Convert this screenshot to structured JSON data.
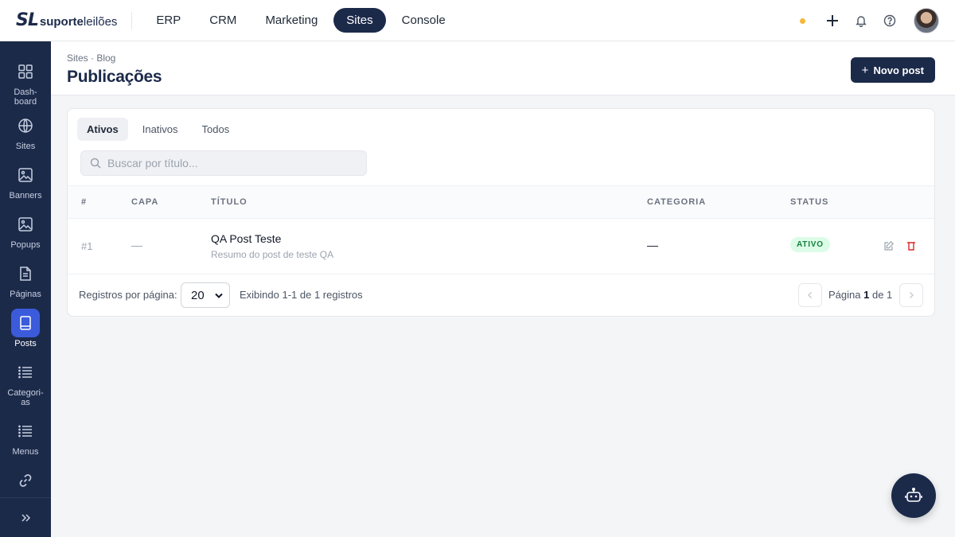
{
  "brand": {
    "mark": "SL",
    "name_bold": "suporte",
    "name_light": "leilões"
  },
  "topnav": {
    "items": [
      {
        "label": "ERP",
        "active": false
      },
      {
        "label": "CRM",
        "active": false
      },
      {
        "label": "Marketing",
        "active": false
      },
      {
        "label": "Sites",
        "active": true
      },
      {
        "label": "Console",
        "active": false
      }
    ],
    "status_dot_color": "#f6b73c",
    "icons": [
      "plus-icon",
      "bell-icon",
      "help-icon"
    ]
  },
  "sidebar": {
    "items": [
      {
        "label": "Dash-\nboard",
        "icon": "grid-icon",
        "active": false
      },
      {
        "label": "Sites",
        "icon": "globe-icon",
        "active": false
      },
      {
        "label": "Banners",
        "icon": "image-icon",
        "active": false
      },
      {
        "label": "Popups",
        "icon": "image-icon",
        "active": false
      },
      {
        "label": "Páginas",
        "icon": "document-icon",
        "active": false
      },
      {
        "label": "Posts",
        "icon": "book-icon",
        "active": true
      },
      {
        "label": "Categori-\nas",
        "icon": "list-icon",
        "active": false
      },
      {
        "label": "Menus",
        "icon": "list-icon",
        "active": false
      },
      {
        "label": "",
        "icon": "link-icon",
        "active": false
      }
    ],
    "expand_icon": "double-chevron-right-icon"
  },
  "header": {
    "breadcrumb": "Sites · Blog",
    "title": "Publicações",
    "new_button": "Novo post"
  },
  "tabs": [
    {
      "label": "Ativos",
      "active": true
    },
    {
      "label": "Inativos",
      "active": false
    },
    {
      "label": "Todos",
      "active": false
    }
  ],
  "search": {
    "placeholder": "Buscar por título...",
    "value": ""
  },
  "table": {
    "columns": [
      "#",
      "CAPA",
      "TÍTULO",
      "CATEGORIA",
      "STATUS"
    ],
    "rows": [
      {
        "num": "#1",
        "cover": "—",
        "title": "QA Post Teste",
        "summary": "Resumo do post de teste QA",
        "category": "—",
        "status": "ATIVO"
      }
    ]
  },
  "footer": {
    "per_page_label": "Registros por página:",
    "per_page_value": "20",
    "showing": "Exibindo 1-1 de 1 registros",
    "page_prefix": "Página",
    "page_current": "1",
    "page_of": "de 1"
  },
  "colors": {
    "navy": "#1c2a4a",
    "accent": "#3b5bdb",
    "status_green": "#15803d",
    "delete_red": "#dc2626"
  }
}
